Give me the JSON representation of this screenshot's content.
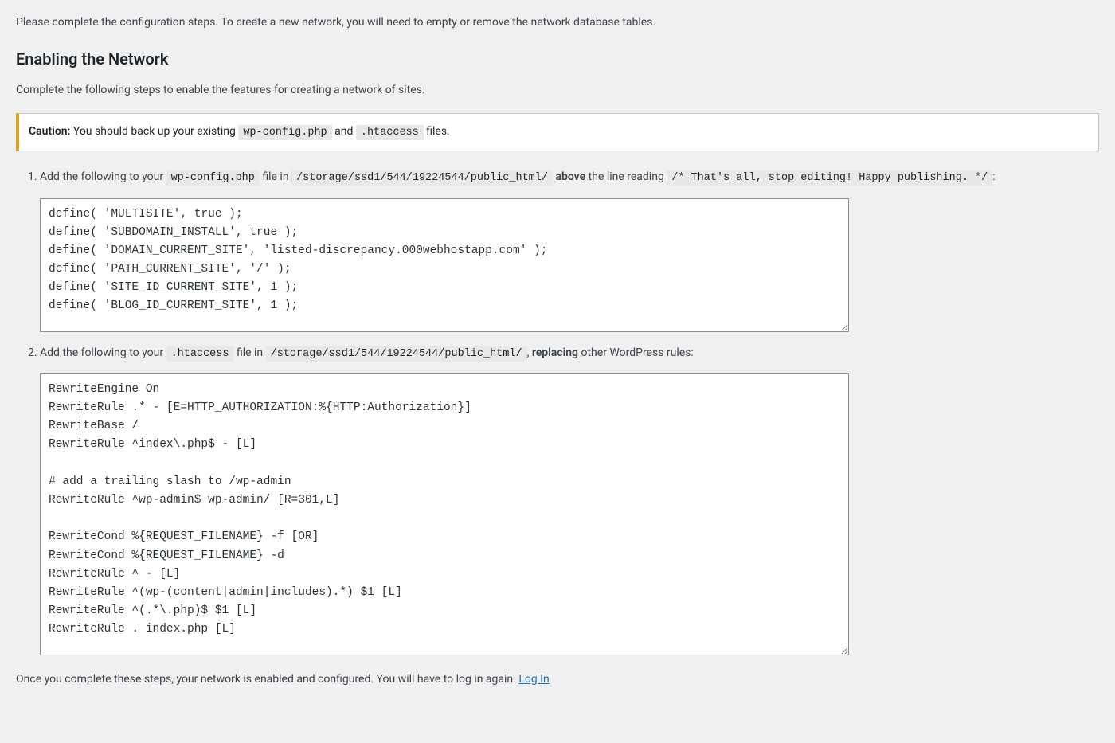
{
  "intro": "Please complete the configuration steps. To create a new network, you will need to empty or remove the network database tables.",
  "heading": "Enabling the Network",
  "subtitle": "Complete the following steps to enable the features for creating a network of sites.",
  "notice": {
    "label": "Caution:",
    "text_before": " You should back up your existing ",
    "file1": "wp-config.php",
    "and": " and ",
    "file2": ".htaccess",
    "text_after": " files."
  },
  "step1": {
    "prefix": "Add the following to your ",
    "file": "wp-config.php",
    "mid1": " file in ",
    "path": "/storage/ssd1/544/19224544/public_html/",
    "above_word": "above",
    "mid2": " the line reading ",
    "comment": "/* That's all, stop editing! Happy publishing. */",
    "suffix": ":",
    "code": "define( 'MULTISITE', true );\ndefine( 'SUBDOMAIN_INSTALL', true );\ndefine( 'DOMAIN_CURRENT_SITE', 'listed-discrepancy.000webhostapp.com' );\ndefine( 'PATH_CURRENT_SITE', '/' );\ndefine( 'SITE_ID_CURRENT_SITE', 1 );\ndefine( 'BLOG_ID_CURRENT_SITE', 1 );"
  },
  "step2": {
    "prefix": "Add the following to your ",
    "file": ".htaccess",
    "mid1": " file in ",
    "path": "/storage/ssd1/544/19224544/public_html/",
    "comma": ", ",
    "replacing_word": "replacing",
    "suffix": " other WordPress rules:",
    "code": "RewriteEngine On\nRewriteRule .* - [E=HTTP_AUTHORIZATION:%{HTTP:Authorization}]\nRewriteBase /\nRewriteRule ^index\\.php$ - [L]\n\n# add a trailing slash to /wp-admin\nRewriteRule ^wp-admin$ wp-admin/ [R=301,L]\n\nRewriteCond %{REQUEST_FILENAME} -f [OR]\nRewriteCond %{REQUEST_FILENAME} -d\nRewriteRule ^ - [L]\nRewriteRule ^(wp-(content|admin|includes).*) $1 [L]\nRewriteRule ^(.*\\.php)$ $1 [L]\nRewriteRule . index.php [L]"
  },
  "footer": {
    "text": "Once you complete these steps, your network is enabled and configured. You will have to log in again. ",
    "link": "Log In"
  }
}
